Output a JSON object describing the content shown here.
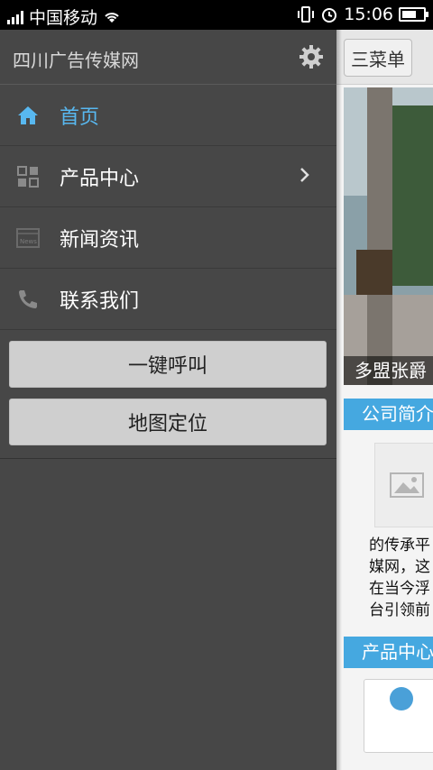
{
  "status_bar": {
    "carrier": "中国移动",
    "time": "15:06",
    "battery_level": 0.7
  },
  "drawer": {
    "title": "四川广告传媒网",
    "menu": [
      {
        "label": "首页",
        "icon": "home-icon",
        "active": true
      },
      {
        "label": "产品中心",
        "icon": "grid-icon",
        "has_submenu": true
      },
      {
        "label": "新闻资讯",
        "icon": "news-icon"
      },
      {
        "label": "联系我们",
        "icon": "phone-icon"
      }
    ],
    "buttons": {
      "call": "一键呼叫",
      "map": "地图定位"
    }
  },
  "content": {
    "menu_button": "三菜单",
    "banner_caption": "多盟张爵",
    "section_company": "公司简介",
    "company_text": [
      "的传承平",
      "媒网，这",
      "在当今浮",
      "台引领前"
    ],
    "section_products": "产品中心"
  },
  "colors": {
    "accent": "#58b8f0",
    "section_blue": "#45a8e0",
    "drawer_bg": "#474747"
  }
}
